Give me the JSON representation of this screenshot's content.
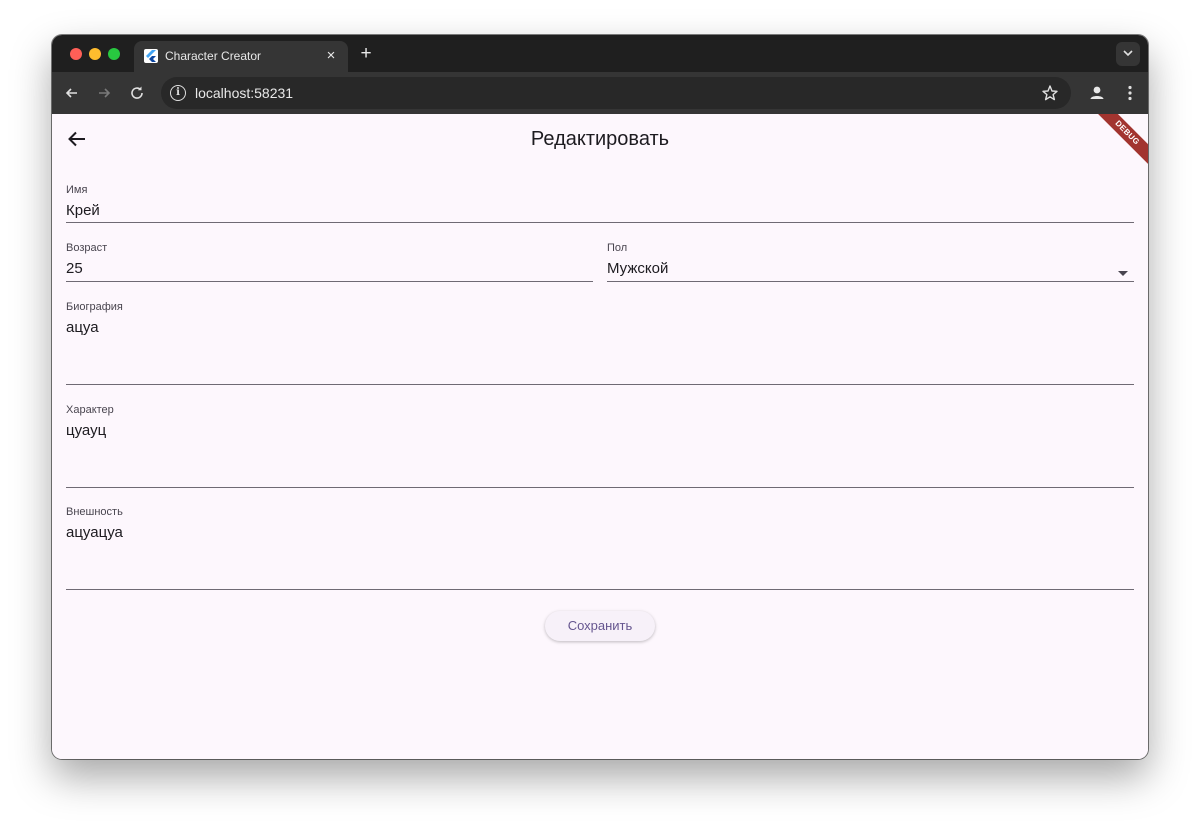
{
  "browser": {
    "tab_title": "Character Creator",
    "tab_close": "×",
    "new_tab": "+",
    "url": "localhost:58231"
  },
  "app": {
    "title": "Редактировать",
    "debug_banner": "DEBUG"
  },
  "form": {
    "name": {
      "label": "Имя",
      "value": "Крей"
    },
    "age": {
      "label": "Возраст",
      "value": "25"
    },
    "gender": {
      "label": "Пол",
      "value": "Мужской"
    },
    "bio": {
      "label": "Биография",
      "value": "ацуа"
    },
    "character": {
      "label": "Характер",
      "value": "цуауц"
    },
    "appearance": {
      "label": "Внешность",
      "value": "ацуацуа"
    },
    "save_label": "Сохранить"
  },
  "colors": {
    "accent": "#65558f",
    "background": "#fdf7fd",
    "debug_ribbon": "#a2342f"
  },
  "icons": [
    "back-arrow-icon",
    "reload-icon",
    "info-icon",
    "star-icon",
    "profile-icon",
    "more-vert-icon",
    "dropdown-arrow-icon",
    "flutter-icon"
  ]
}
